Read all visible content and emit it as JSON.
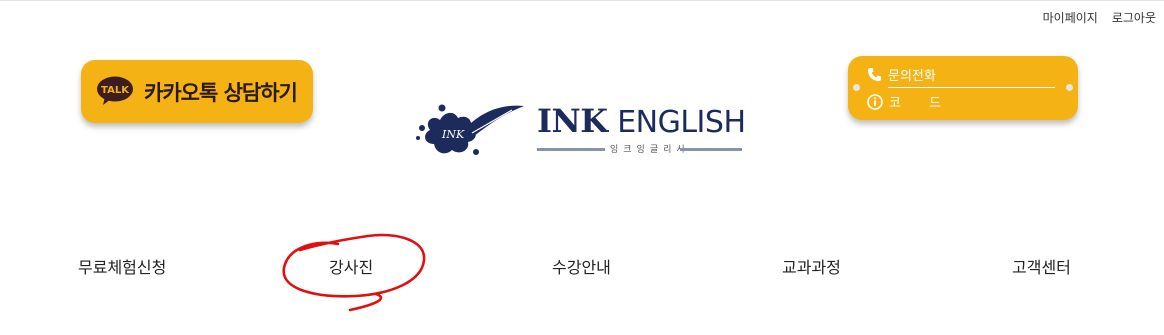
{
  "util_links": [
    "마이페이지",
    "로그아웃"
  ],
  "kakao": {
    "badge": "TALK",
    "label": "카카오톡 상담하기"
  },
  "logo": {
    "mark_text": "INK",
    "title_bold": "INK",
    "title_light": "ENGLISH",
    "subtitle": "잉크잉글리시"
  },
  "contact": {
    "phone_label": "문의전화",
    "code_label": "코 드"
  },
  "nav": [
    "무료체험신청",
    "강사진",
    "수강안내",
    "교과과정",
    "고객센터"
  ],
  "colors": {
    "accent": "#f5b214",
    "brand_navy": "#1d2a5c",
    "scribble": "#e01010"
  }
}
